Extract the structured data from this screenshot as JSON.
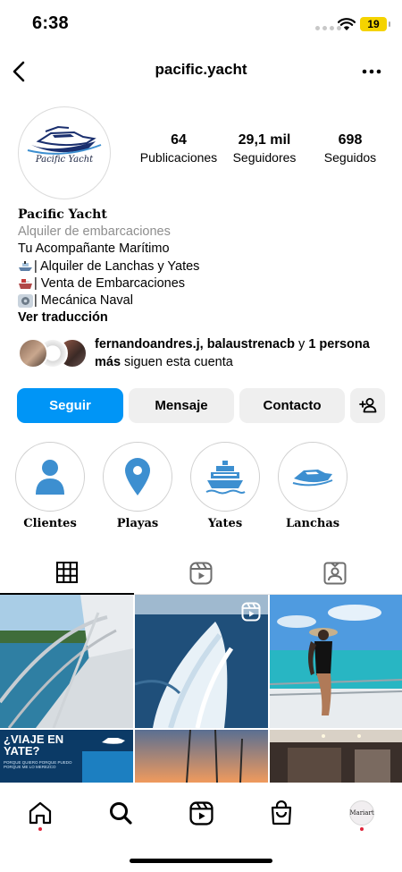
{
  "status_bar": {
    "time": "6:38",
    "battery": "19"
  },
  "header": {
    "username": "pacific.yacht"
  },
  "profile": {
    "avatar_caption": "Pacific Yacht",
    "stats": [
      {
        "value": "64",
        "label": "Publicaciones"
      },
      {
        "value": "29,1 mil",
        "label": "Seguidores"
      },
      {
        "value": "698",
        "label": "Seguidos"
      }
    ],
    "name": "Pacific Yacht",
    "category": "Alquiler de embarcaciones",
    "bio_lines": [
      "Tu Acompañante Marítimo",
      "| Alquiler de Lanchas y Yates",
      "| Venta de Embarcaciones",
      "| Mecánica Naval"
    ],
    "bio_icons": [
      "speedboat-icon",
      "ship-icon",
      "gear-icon"
    ],
    "translate_link": "Ver traducción",
    "followed_by": {
      "names": "fernandoandres.j, balaustrenacb",
      "connector": " y ",
      "others": "1 persona más",
      "suffix": " siguen esta cuenta"
    }
  },
  "actions": {
    "follow": "Seguir",
    "message": "Mensaje",
    "contact": "Contacto"
  },
  "highlights": [
    {
      "label": "Clientes",
      "icon": "person-icon"
    },
    {
      "label": "Playas",
      "icon": "location-pin-icon"
    },
    {
      "label": "Yates",
      "icon": "yacht-icon"
    },
    {
      "label": "Lanchas",
      "icon": "speedboat-icon"
    }
  ],
  "tabs": [
    {
      "name": "grid-icon",
      "active": true
    },
    {
      "name": "reels-icon",
      "active": false
    },
    {
      "name": "tagged-icon",
      "active": false
    }
  ],
  "grid_posts": {
    "promo_title": "¿VIAJE EN YATE?",
    "promo_sub": "PORQUE QUIERO PORQUE PUEDO PORQUE ME LO MEREZCO"
  },
  "bottom_nav": {
    "items": [
      "home-icon",
      "search-icon",
      "reels-icon",
      "shop-icon",
      "profile-avatar"
    ],
    "profile_avatar_text": "Mariart"
  },
  "colors": {
    "accent": "#0095f6",
    "brand_blue": "#3d8fd0",
    "notification": "#e0243a"
  }
}
